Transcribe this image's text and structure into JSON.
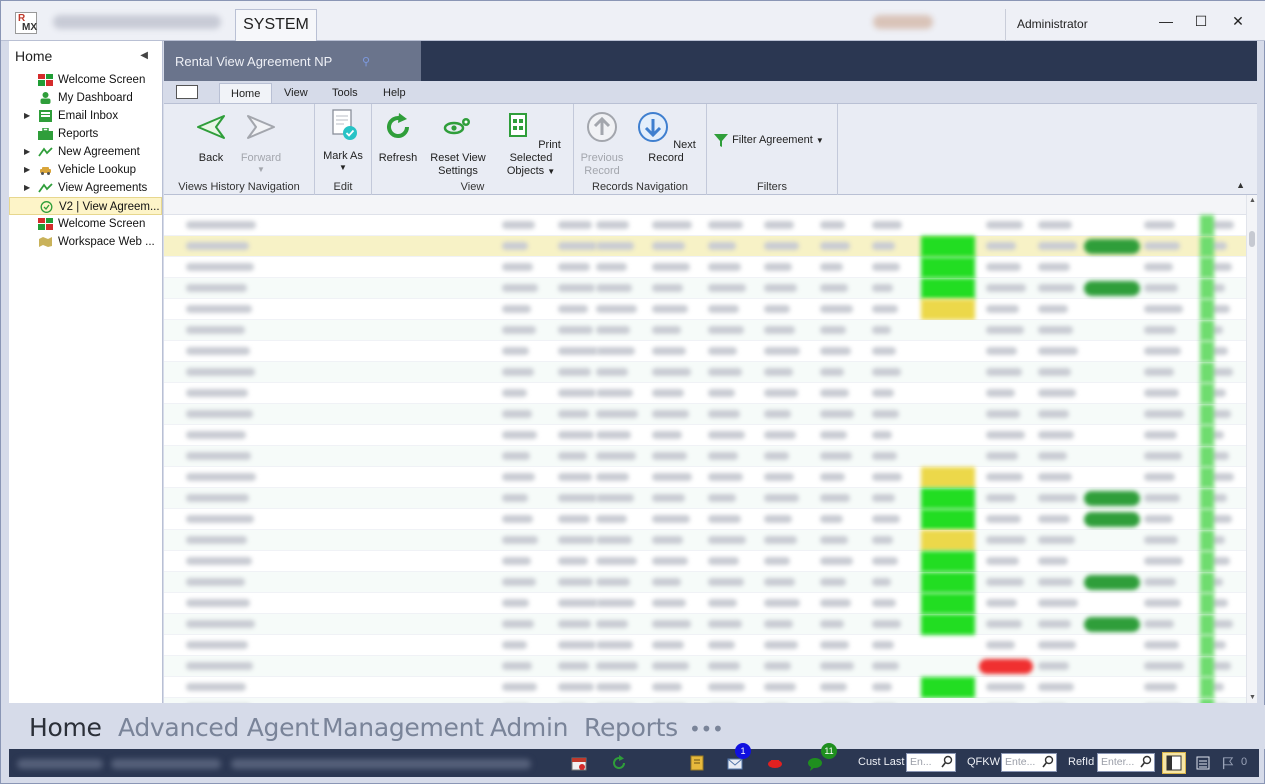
{
  "titlebar": {
    "system_tab": "SYSTEM",
    "user": "Administrator",
    "minimize": "—",
    "maximize": "☐",
    "close": "✕"
  },
  "sidebar": {
    "title": "Home",
    "items": [
      {
        "label": "Welcome Screen",
        "icon": "welcome-icon"
      },
      {
        "label": "My Dashboard",
        "icon": "user-icon"
      },
      {
        "label": "Email Inbox",
        "icon": "email-icon",
        "expandable": true
      },
      {
        "label": "Reports",
        "icon": "briefcase-icon"
      },
      {
        "label": "New Agreement",
        "icon": "agreement-icon",
        "expandable": true
      },
      {
        "label": "Vehicle Lookup",
        "icon": "car-icon",
        "expandable": true
      },
      {
        "label": "View Agreements",
        "icon": "agreement-icon",
        "expandable": true
      },
      {
        "label": "V2 | View Agreem...",
        "icon": "check-icon",
        "selected": true
      },
      {
        "label": "Welcome Screen",
        "icon": "welcome-icon"
      },
      {
        "label": "Workspace Web ...",
        "icon": "map-icon"
      }
    ]
  },
  "document_tab": {
    "title": "Rental View Agreement NP"
  },
  "ribbon": {
    "tabs": [
      "Home",
      "View",
      "Tools",
      "Help"
    ],
    "active_tab": "Home",
    "groups": {
      "history": {
        "label": "Views History Navigation",
        "back": "Back",
        "forward": "Forward"
      },
      "edit": {
        "label": "Edit",
        "mark_as": "Mark As"
      },
      "view": {
        "label": "View",
        "refresh": "Refresh",
        "reset_line1": "Reset View",
        "reset_line2": "Settings",
        "print_line1": "Print Selected",
        "print_line2": "Objects"
      },
      "records": {
        "label": "Records Navigation",
        "prev_line1": "Previous",
        "prev_line2": "Record",
        "next": "Next Record"
      },
      "filters": {
        "label": "Filters",
        "filter_agreement": "Filter Agreement"
      }
    }
  },
  "bottom_nav": {
    "items": [
      "Home",
      "Advanced Agent",
      "Management",
      "Admin",
      "Reports",
      "•••"
    ],
    "active": "Home"
  },
  "statusbar": {
    "badge_mail": "1",
    "badge_chat": "11",
    "cust_last_label": "Cust Last",
    "cust_last_placeholder": "En...",
    "qfkw_label": "QFKW",
    "qfkw_placeholder": "Ente...",
    "refid_label": "RefId",
    "refid_placeholder": "Enter...",
    "count": "0"
  },
  "colors": {
    "title_bg": "#eef0f6",
    "doc_bar": "#2b3752",
    "status_green": "#22dd22",
    "status_dark_green": "#2f9e3a",
    "status_yellow": "#ecd84a",
    "status_red": "#f03030",
    "badge_blue": "#1010e0",
    "badge_green": "#1f8f1f"
  }
}
